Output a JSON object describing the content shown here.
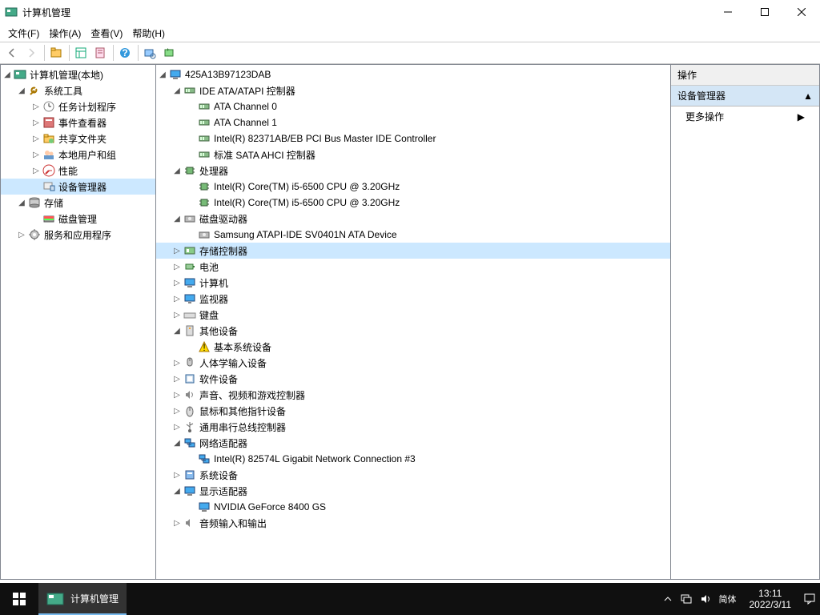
{
  "window": {
    "title": "计算机管理"
  },
  "menu": [
    "文件(F)",
    "操作(A)",
    "查看(V)",
    "帮助(H)"
  ],
  "leftTree": {
    "root": {
      "label": "计算机管理(本地)",
      "icon": "computer-mgmt-icon",
      "open": true,
      "children": [
        {
          "label": "系统工具",
          "icon": "tools-icon",
          "open": true,
          "children": [
            {
              "label": "任务计划程序",
              "icon": "scheduler-icon",
              "expandable": true
            },
            {
              "label": "事件查看器",
              "icon": "event-viewer-icon",
              "expandable": true
            },
            {
              "label": "共享文件夹",
              "icon": "shared-folders-icon",
              "expandable": true
            },
            {
              "label": "本地用户和组",
              "icon": "users-groups-icon",
              "expandable": true
            },
            {
              "label": "性能",
              "icon": "performance-icon",
              "expandable": true
            },
            {
              "label": "设备管理器",
              "icon": "device-manager-icon",
              "selected": true
            }
          ]
        },
        {
          "label": "存储",
          "icon": "storage-icon",
          "open": true,
          "children": [
            {
              "label": "磁盘管理",
              "icon": "disk-mgmt-icon"
            }
          ]
        },
        {
          "label": "服务和应用程序",
          "icon": "services-icon",
          "expandable": true
        }
      ]
    }
  },
  "deviceTree": {
    "computer": "425A13B97123DAB",
    "categories": [
      {
        "label": "IDE ATA/ATAPI 控制器",
        "icon": "ide-icon",
        "open": true,
        "children": [
          {
            "label": "ATA Channel 0",
            "icon": "ide-icon"
          },
          {
            "label": "ATA Channel 1",
            "icon": "ide-icon"
          },
          {
            "label": "Intel(R) 82371AB/EB PCI Bus Master IDE Controller",
            "icon": "ide-icon"
          },
          {
            "label": "标准 SATA AHCI 控制器",
            "icon": "ide-icon"
          }
        ]
      },
      {
        "label": "处理器",
        "icon": "cpu-icon",
        "open": true,
        "children": [
          {
            "label": "Intel(R) Core(TM) i5-6500 CPU @ 3.20GHz",
            "icon": "cpu-icon"
          },
          {
            "label": "Intel(R) Core(TM) i5-6500 CPU @ 3.20GHz",
            "icon": "cpu-icon"
          }
        ]
      },
      {
        "label": "磁盘驱动器",
        "icon": "disk-icon",
        "open": true,
        "children": [
          {
            "label": "Samsung ATAPI-IDE SV0401N ATA Device",
            "icon": "disk-icon"
          }
        ]
      },
      {
        "label": "存储控制器",
        "icon": "storage-ctrl-icon",
        "selected": true,
        "expandable": true
      },
      {
        "label": "电池",
        "icon": "battery-icon",
        "expandable": true
      },
      {
        "label": "计算机",
        "icon": "computer-icon",
        "expandable": true
      },
      {
        "label": "监视器",
        "icon": "monitor-icon",
        "expandable": true
      },
      {
        "label": "键盘",
        "icon": "keyboard-icon",
        "expandable": true
      },
      {
        "label": "其他设备",
        "icon": "other-icon",
        "open": true,
        "children": [
          {
            "label": "基本系统设备",
            "icon": "warning-icon"
          }
        ]
      },
      {
        "label": "人体学输入设备",
        "icon": "hid-icon",
        "expandable": true
      },
      {
        "label": "软件设备",
        "icon": "software-icon",
        "expandable": true
      },
      {
        "label": "声音、视频和游戏控制器",
        "icon": "sound-icon",
        "expandable": true
      },
      {
        "label": "鼠标和其他指针设备",
        "icon": "mouse-icon",
        "expandable": true
      },
      {
        "label": "通用串行总线控制器",
        "icon": "usb-icon",
        "expandable": true
      },
      {
        "label": "网络适配器",
        "icon": "network-icon",
        "open": true,
        "children": [
          {
            "label": "Intel(R) 82574L Gigabit Network Connection #3",
            "icon": "network-icon"
          }
        ]
      },
      {
        "label": "系统设备",
        "icon": "system-icon",
        "expandable": true
      },
      {
        "label": "显示适配器",
        "icon": "display-icon",
        "open": true,
        "children": [
          {
            "label": "NVIDIA GeForce 8400 GS",
            "icon": "display-icon"
          }
        ]
      },
      {
        "label": "音频输入和输出",
        "icon": "audio-io-icon",
        "expandable": true
      }
    ]
  },
  "actions": {
    "heading": "操作",
    "category": "设备管理器",
    "more": "更多操作"
  },
  "taskbar": {
    "task": "计算机管理",
    "ime": "简体",
    "time": "13:11",
    "date": "2022/3/11"
  }
}
